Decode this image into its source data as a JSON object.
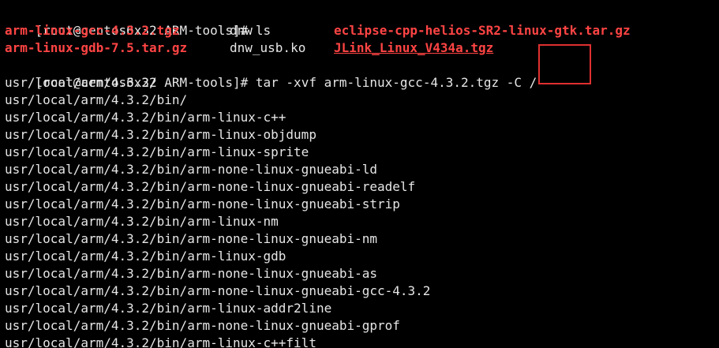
{
  "colors": {
    "background": "#000000",
    "text": "#e6e6e6",
    "archive": "#ff4444",
    "highlight_box": "#e03030"
  },
  "prompt1": {
    "prompt": "[root@centos6x32 ARM-tools]# ",
    "command": "ls"
  },
  "ls_row1": {
    "col1": "arm-linux-gcc-4.3.2.tgz",
    "col2": "dnw",
    "col3": "eclipse-cpp-helios-SR2-linux-gtk.tar.gz"
  },
  "ls_row2": {
    "col1": "arm-linux-gdb-7.5.tar.gz",
    "col2": "dnw_usb.ko",
    "col3": "JLink_Linux_V434a.tgz"
  },
  "prompt2": {
    "prompt": "[root@centos6x32 ARM-tools]# ",
    "command": "tar -xvf arm-linux-gcc-4.3.2.tgz ",
    "option": "-C /"
  },
  "output": [
    "usr/local/arm/4.3.2/",
    "usr/local/arm/4.3.2/bin/",
    "usr/local/arm/4.3.2/bin/arm-linux-c++",
    "usr/local/arm/4.3.2/bin/arm-linux-objdump",
    "usr/local/arm/4.3.2/bin/arm-linux-sprite",
    "usr/local/arm/4.3.2/bin/arm-none-linux-gnueabi-ld",
    "usr/local/arm/4.3.2/bin/arm-none-linux-gnueabi-readelf",
    "usr/local/arm/4.3.2/bin/arm-none-linux-gnueabi-strip",
    "usr/local/arm/4.3.2/bin/arm-linux-nm",
    "usr/local/arm/4.3.2/bin/arm-none-linux-gnueabi-nm",
    "usr/local/arm/4.3.2/bin/arm-linux-gdb",
    "usr/local/arm/4.3.2/bin/arm-none-linux-gnueabi-as",
    "usr/local/arm/4.3.2/bin/arm-none-linux-gnueabi-gcc-4.3.2",
    "usr/local/arm/4.3.2/bin/arm-linux-addr2line",
    "usr/local/arm/4.3.2/bin/arm-none-linux-gnueabi-gprof",
    "usr/local/arm/4.3.2/bin/arm-linux-c++filt"
  ]
}
